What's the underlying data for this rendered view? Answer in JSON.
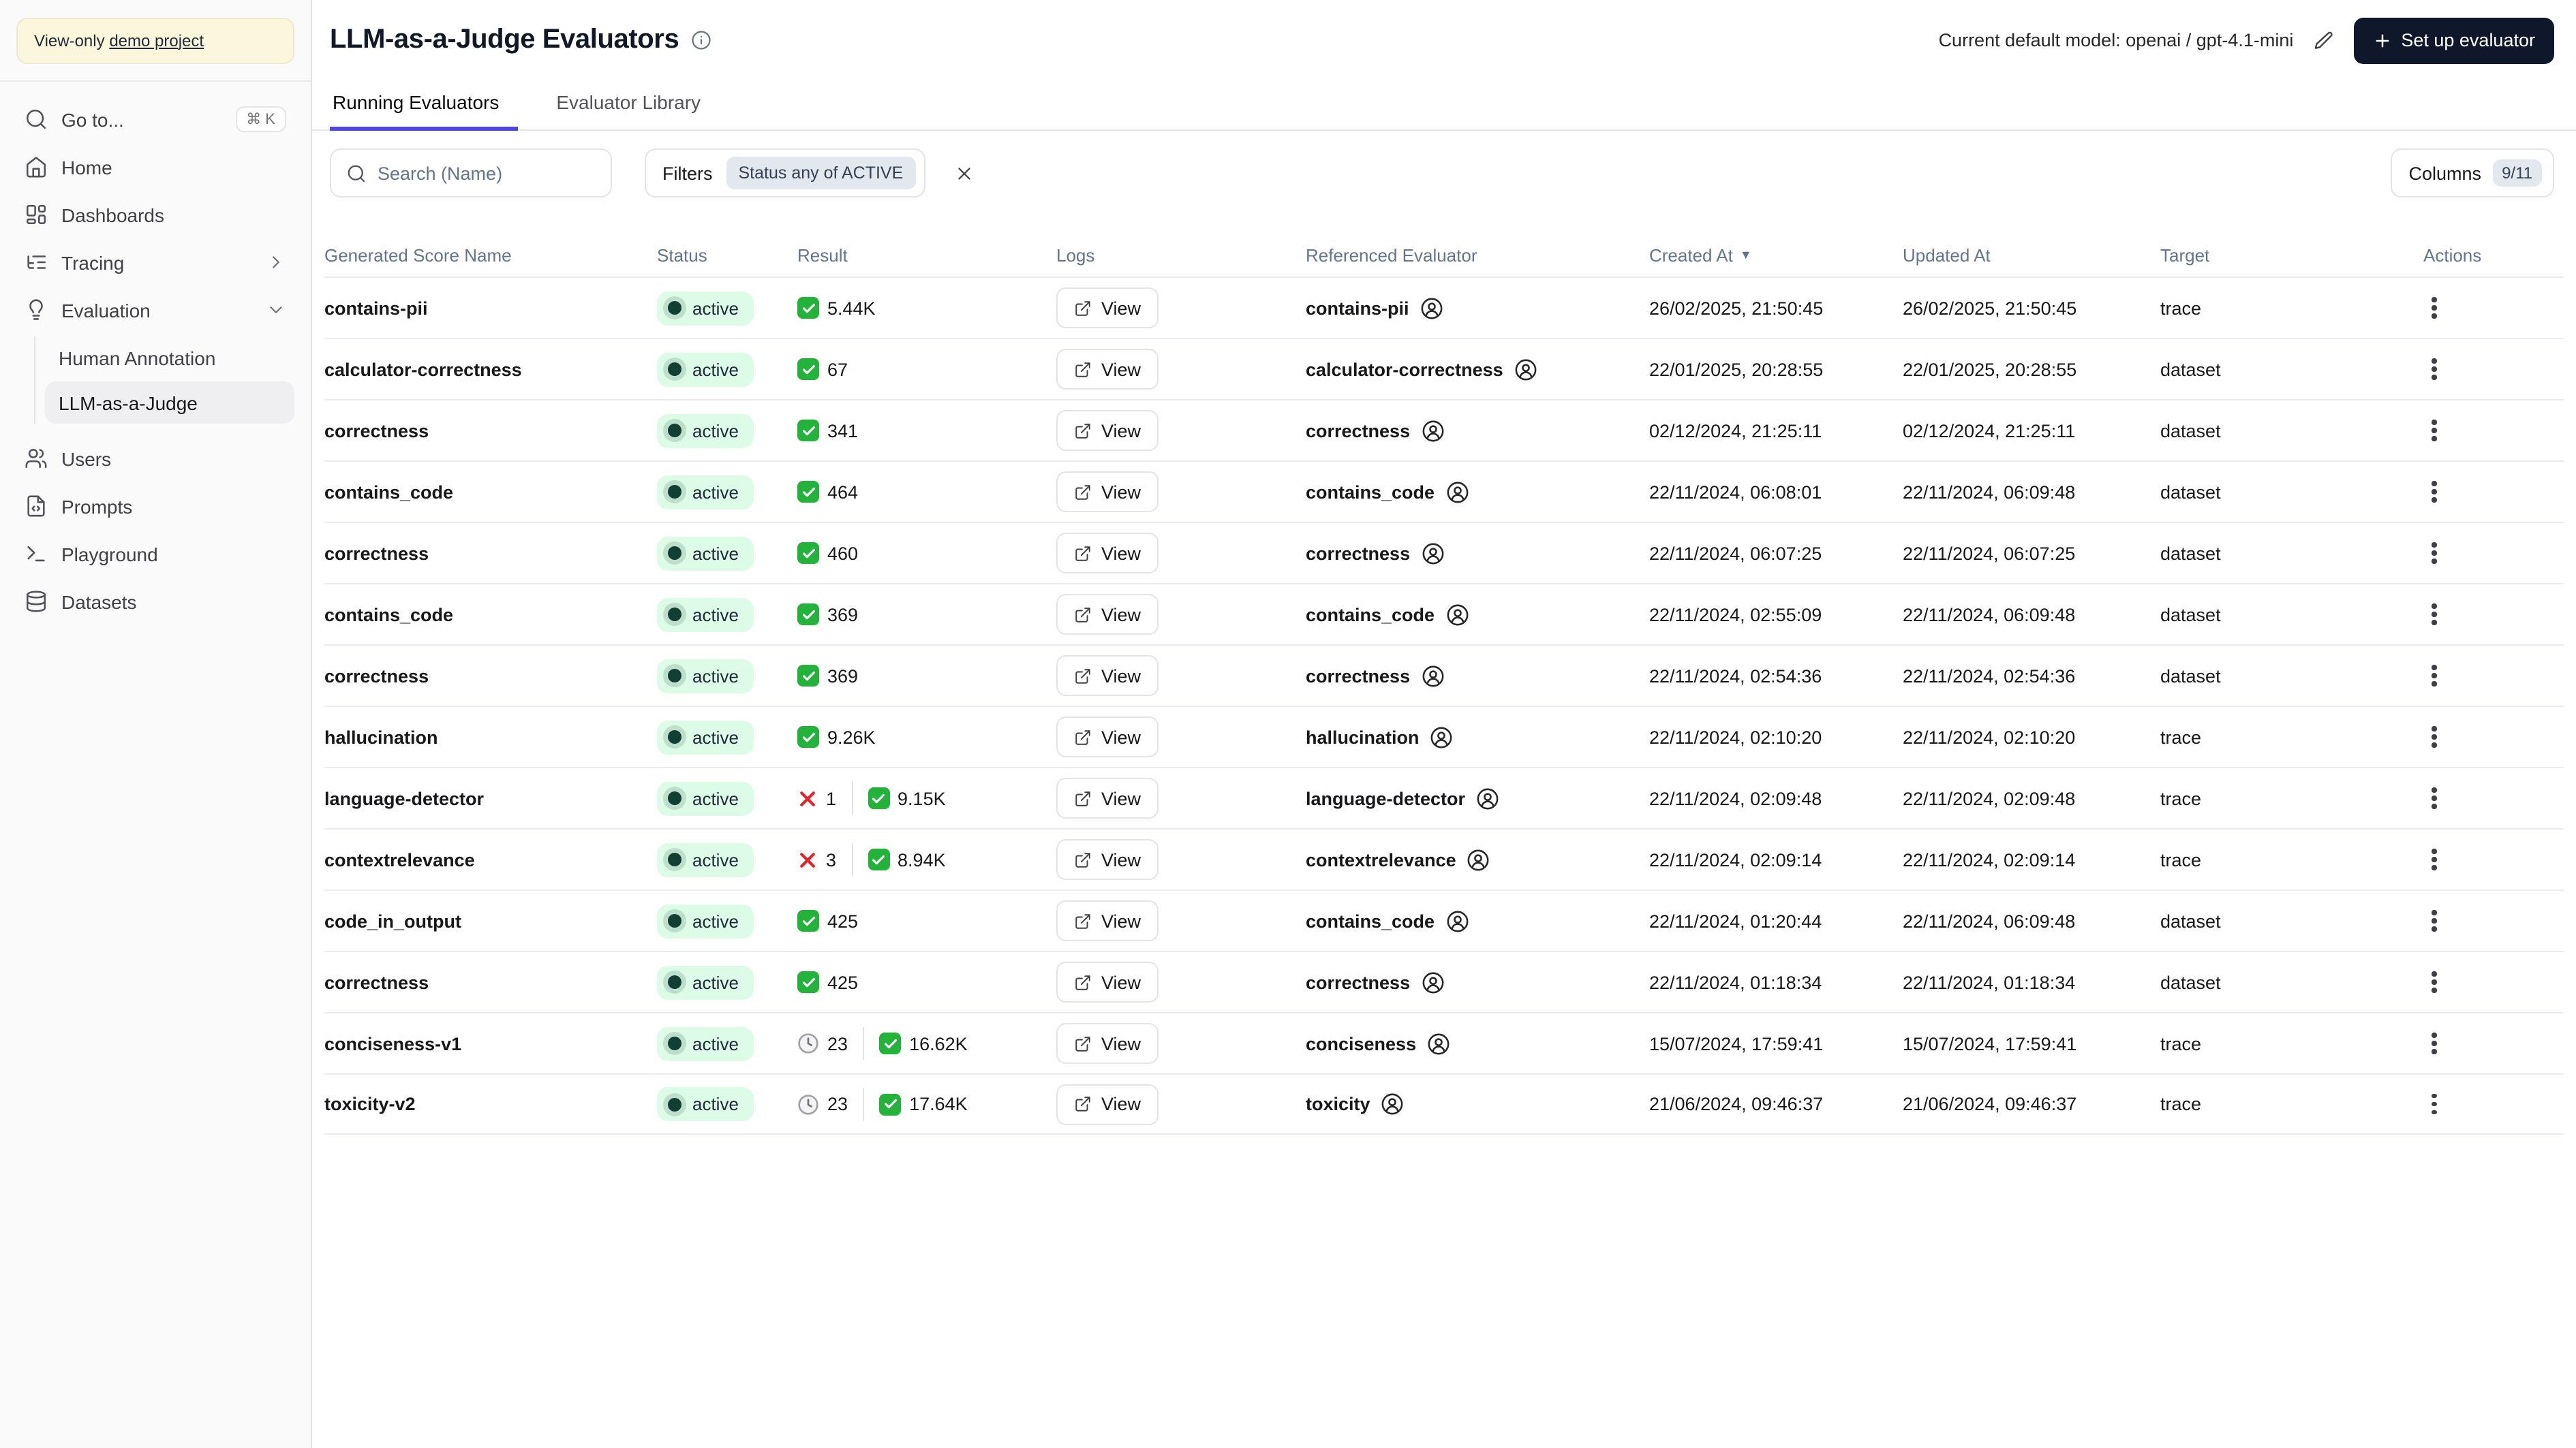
{
  "banner": {
    "text": "View-only",
    "link_text": "demo project"
  },
  "sidebar": {
    "goto_label": "Go to...",
    "goto_shortcut": "⌘ K",
    "items": [
      {
        "label": "Home"
      },
      {
        "label": "Dashboards"
      },
      {
        "label": "Tracing"
      },
      {
        "label": "Evaluation"
      }
    ],
    "evaluation_children": [
      {
        "label": "Human Annotation"
      },
      {
        "label": "LLM-as-a-Judge"
      }
    ],
    "bottom_items": [
      {
        "label": "Users"
      },
      {
        "label": "Prompts"
      },
      {
        "label": "Playground"
      },
      {
        "label": "Datasets"
      }
    ]
  },
  "header": {
    "title": "LLM-as-a-Judge Evaluators",
    "default_model_label": "Current default model: openai / gpt-4.1-mini",
    "setup_button_label": "Set up evaluator"
  },
  "tabs": {
    "running": "Running Evaluators",
    "library": "Evaluator Library"
  },
  "toolbar": {
    "search_placeholder": "Search (Name)",
    "filters_label": "Filters",
    "filter_chip": "Status any of ACTIVE",
    "columns_label": "Columns",
    "columns_badge": "9/11"
  },
  "colors": {
    "accent": "#4f46e5",
    "status_badge_bg": "#dcfce7",
    "status_dot": "#123f33",
    "check_green": "#23b33b",
    "cross_red": "#e2252b",
    "banner_bg": "#fcf6dc",
    "button_dark": "#0f172a"
  },
  "table": {
    "columns": [
      "Generated Score Name",
      "Status",
      "Result",
      "Logs",
      "Referenced Evaluator",
      "Created At",
      "Updated At",
      "Target",
      "Actions"
    ],
    "sort_indicator": "▼",
    "view_label": "View",
    "rows": [
      {
        "name": "contains-pii",
        "status": "active",
        "result": [
          {
            "icon": "check",
            "value": "5.44K"
          }
        ],
        "referenced": "contains-pii",
        "created": "26/02/2025, 21:50:45",
        "updated": "26/02/2025, 21:50:45",
        "target": "trace"
      },
      {
        "name": "calculator-correctness",
        "status": "active",
        "result": [
          {
            "icon": "check",
            "value": "67"
          }
        ],
        "referenced": "calculator-correctness",
        "created": "22/01/2025, 20:28:55",
        "updated": "22/01/2025, 20:28:55",
        "target": "dataset"
      },
      {
        "name": "correctness",
        "status": "active",
        "result": [
          {
            "icon": "check",
            "value": "341"
          }
        ],
        "referenced": "correctness",
        "created": "02/12/2024, 21:25:11",
        "updated": "02/12/2024, 21:25:11",
        "target": "dataset"
      },
      {
        "name": "contains_code",
        "status": "active",
        "result": [
          {
            "icon": "check",
            "value": "464"
          }
        ],
        "referenced": "contains_code",
        "created": "22/11/2024, 06:08:01",
        "updated": "22/11/2024, 06:09:48",
        "target": "dataset"
      },
      {
        "name": "correctness",
        "status": "active",
        "result": [
          {
            "icon": "check",
            "value": "460"
          }
        ],
        "referenced": "correctness",
        "created": "22/11/2024, 06:07:25",
        "updated": "22/11/2024, 06:07:25",
        "target": "dataset"
      },
      {
        "name": "contains_code",
        "status": "active",
        "result": [
          {
            "icon": "check",
            "value": "369"
          }
        ],
        "referenced": "contains_code",
        "created": "22/11/2024, 02:55:09",
        "updated": "22/11/2024, 06:09:48",
        "target": "dataset"
      },
      {
        "name": "correctness",
        "status": "active",
        "result": [
          {
            "icon": "check",
            "value": "369"
          }
        ],
        "referenced": "correctness",
        "created": "22/11/2024, 02:54:36",
        "updated": "22/11/2024, 02:54:36",
        "target": "dataset"
      },
      {
        "name": "hallucination",
        "status": "active",
        "result": [
          {
            "icon": "check",
            "value": "9.26K"
          }
        ],
        "referenced": "hallucination",
        "created": "22/11/2024, 02:10:20",
        "updated": "22/11/2024, 02:10:20",
        "target": "trace"
      },
      {
        "name": "language-detector",
        "status": "active",
        "result": [
          {
            "icon": "cross",
            "value": "1"
          },
          {
            "icon": "check",
            "value": "9.15K"
          }
        ],
        "referenced": "language-detector",
        "created": "22/11/2024, 02:09:48",
        "updated": "22/11/2024, 02:09:48",
        "target": "trace"
      },
      {
        "name": "contextrelevance",
        "status": "active",
        "result": [
          {
            "icon": "cross",
            "value": "3"
          },
          {
            "icon": "check",
            "value": "8.94K"
          }
        ],
        "referenced": "contextrelevance",
        "created": "22/11/2024, 02:09:14",
        "updated": "22/11/2024, 02:09:14",
        "target": "trace"
      },
      {
        "name": "code_in_output",
        "status": "active",
        "result": [
          {
            "icon": "check",
            "value": "425"
          }
        ],
        "referenced": "contains_code",
        "created": "22/11/2024, 01:20:44",
        "updated": "22/11/2024, 06:09:48",
        "target": "dataset"
      },
      {
        "name": "correctness",
        "status": "active",
        "result": [
          {
            "icon": "check",
            "value": "425"
          }
        ],
        "referenced": "correctness",
        "created": "22/11/2024, 01:18:34",
        "updated": "22/11/2024, 01:18:34",
        "target": "dataset"
      },
      {
        "name": "conciseness-v1",
        "status": "active",
        "result": [
          {
            "icon": "clock",
            "value": "23"
          },
          {
            "icon": "check",
            "value": "16.62K"
          }
        ],
        "referenced": "conciseness",
        "created": "15/07/2024, 17:59:41",
        "updated": "15/07/2024, 17:59:41",
        "target": "trace"
      },
      {
        "name": "toxicity-v2",
        "status": "active",
        "result": [
          {
            "icon": "clock",
            "value": "23"
          },
          {
            "icon": "check",
            "value": "17.64K"
          }
        ],
        "referenced": "toxicity",
        "created": "21/06/2024, 09:46:37",
        "updated": "21/06/2024, 09:46:37",
        "target": "trace"
      }
    ]
  }
}
